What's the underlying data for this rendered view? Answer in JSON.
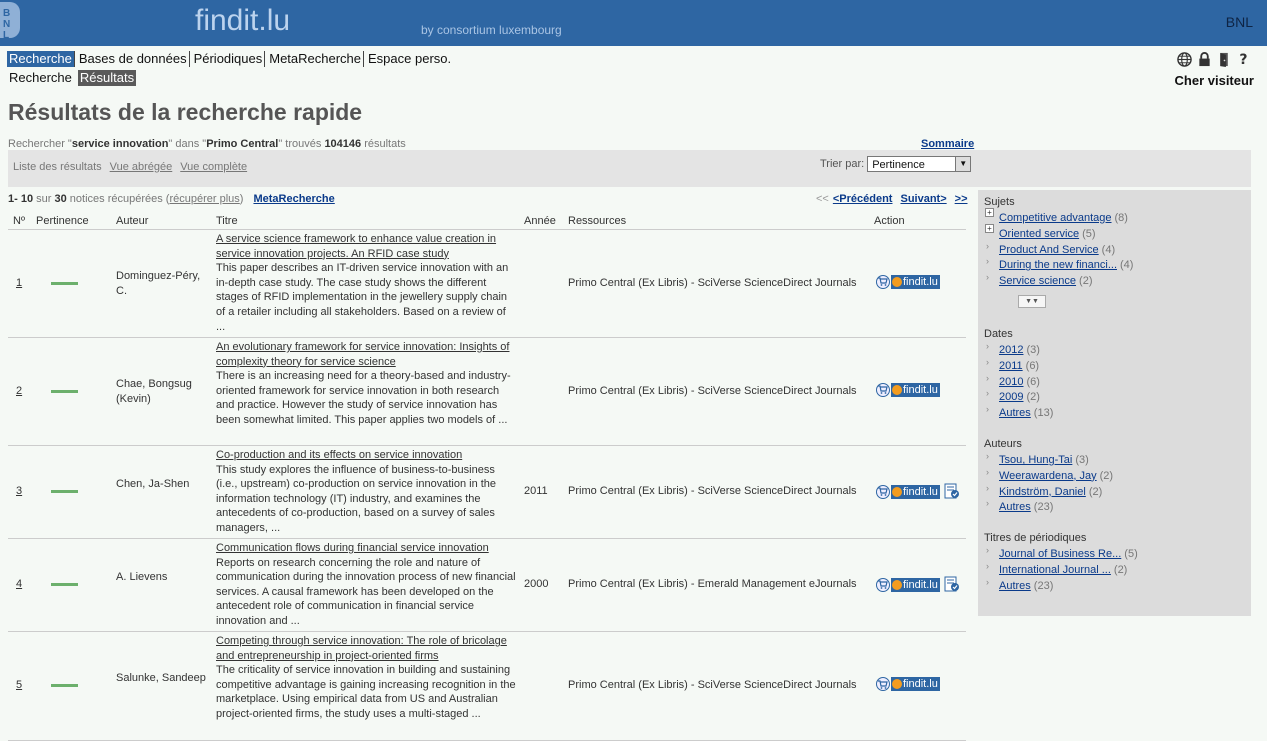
{
  "header": {
    "logo_letters": "B\nN\nL",
    "brand": "findit.lu",
    "byline": "by consortium luxembourg",
    "org": "BNL"
  },
  "nav": {
    "primary": [
      {
        "label": "Recherche",
        "active": true
      },
      {
        "label": "Bases de données",
        "active": false
      },
      {
        "label": "Périodiques",
        "active": false
      },
      {
        "label": "MetaRecherche",
        "active": false
      },
      {
        "label": "Espace perso.",
        "active": false
      }
    ],
    "secondary": [
      {
        "label": "Recherche",
        "active": false
      },
      {
        "label": "Résultats",
        "active": true
      }
    ],
    "tools": [
      "globe-icon",
      "lock-icon",
      "logout-icon",
      "help-icon"
    ],
    "visitor": "Cher visiteur"
  },
  "page": {
    "title": "Résultats de la recherche rapide",
    "summary": {
      "prefix": "Rechercher \"",
      "query": "service innovation",
      "mid1": "\" dans \"",
      "source": "Primo Central",
      "mid2": "\" trouvés ",
      "count": "104146",
      "suffix": " résultats"
    },
    "sommaire": "Sommaire"
  },
  "options": {
    "list_label": "Liste des résultats",
    "view_short": "Vue abrégée",
    "view_full": "Vue complète",
    "sort_label": "Trier par:",
    "sort_value": "Pertinence"
  },
  "results_meta": {
    "range": "1- 10",
    "sur": " sur ",
    "total": "30",
    "retrieved": " notices récupérées (",
    "more": "récupérer plus",
    "close": ")",
    "metasearch": "MetaRecherche"
  },
  "pager": {
    "first": "<<",
    "prev": "<Précédent",
    "next": "Suivant>",
    "last": ">>"
  },
  "table": {
    "headers": {
      "num": "Nº",
      "relevance": "Pertinence",
      "author": "Auteur",
      "title": "Titre",
      "year": "Année",
      "resources": "Ressources",
      "action": "Action"
    },
    "rows": [
      {
        "num": "1",
        "relevance": 0.9,
        "author": "Dominguez-Péry, C.",
        "title": "A service science framework to enhance value creation in service innovation projects. An RFID case study",
        "abstract": "This paper describes an IT-driven service innovation with an in-depth case study. The case study shows the different stages of RFID implementation in the jewellery supply chain of a retailer including all stakeholders. Based on a review of ...",
        "year": "",
        "resource": "Primo Central (Ex Libris) - SciVerse ScienceDirect Journals",
        "doc_icon": false
      },
      {
        "num": "2",
        "relevance": 0.9,
        "author": "Chae, Bongsug (Kevin)",
        "title": "An evolutionary framework for service innovation: Insights of complexity theory for service science",
        "abstract": "There is an increasing need for a theory-based and industry-oriented framework for service innovation in both research and practice. However the study of service innovation has been somewhat limited. This paper applies two models of ...",
        "year": "",
        "resource": "Primo Central (Ex Libris) - SciVerse ScienceDirect Journals",
        "doc_icon": false
      },
      {
        "num": "3",
        "relevance": 0.9,
        "author": "Chen, Ja-Shen",
        "title": "Co-production and its effects on service innovation",
        "abstract": "This study explores the influence of business-to-business (i.e., upstream) co-production on service innovation in the information technology (IT) industry, and examines the antecedents of co-production, based on a survey of sales managers, ...",
        "year": "2011",
        "resource": "Primo Central (Ex Libris) - SciVerse ScienceDirect Journals",
        "doc_icon": true
      },
      {
        "num": "4",
        "relevance": 0.9,
        "author": "A. Lievens",
        "title": "Communication flows during financial service innovation",
        "abstract": "Reports on research concerning the role and nature of communication during the innovation process of new financial services. A causal framework has been developed on the antecedent role of communication in financial service innovation and ...",
        "year": "2000",
        "resource": "Primo Central (Ex Libris) - Emerald Management eJournals",
        "doc_icon": true
      },
      {
        "num": "5",
        "relevance": 0.9,
        "author": "Salunke, Sandeep",
        "title": "Competing through service innovation: The role of bricolage and entrepreneurship in project-oriented firms",
        "abstract": "The criticality of service innovation in building and sustaining competitive advantage is gaining increasing recognition in the marketplace. Using empirical data from US and Australian project-oriented firms, the study uses a multi-staged ...",
        "year": "",
        "resource": "Primo Central (Ex Libris) - SciVerse ScienceDirect Journals",
        "doc_icon": false
      }
    ],
    "action_badge": "findit.lu"
  },
  "facets": {
    "subjects": {
      "title": "Sujets",
      "items": [
        {
          "label": "Competitive advantage ",
          "count": "(8)",
          "marker": "plus"
        },
        {
          "label": "Oriented service ",
          "count": "(5)",
          "marker": "plus"
        },
        {
          "label": "Product And Service ",
          "count": "(4)",
          "marker": "arrow"
        },
        {
          "label": "During the new financi... ",
          "count": "(4)",
          "marker": "arrow"
        },
        {
          "label": "Service science ",
          "count": "(2)",
          "marker": "arrow"
        }
      ]
    },
    "dates": {
      "title": "Dates",
      "items": [
        {
          "label": "2012 ",
          "count": "(3)"
        },
        {
          "label": "2011 ",
          "count": "(6)"
        },
        {
          "label": "2010 ",
          "count": "(6)"
        },
        {
          "label": "2009 ",
          "count": "(2)"
        },
        {
          "label": "Autres ",
          "count": "(13)"
        }
      ]
    },
    "authors": {
      "title": "Auteurs",
      "items": [
        {
          "label": "Tsou, Hung-Tai ",
          "count": "(3)"
        },
        {
          "label": "Weerawardena, Jay ",
          "count": "(2)"
        },
        {
          "label": "Kindström, Daniel ",
          "count": "(2)"
        },
        {
          "label": "Autres ",
          "count": "(23)"
        }
      ]
    },
    "journals": {
      "title": "Titres de périodiques",
      "items": [
        {
          "label": "Journal of Business Re... ",
          "count": "(5)"
        },
        {
          "label": "International Journal ... ",
          "count": "(2)"
        },
        {
          "label": "Autres ",
          "count": "(23)"
        }
      ]
    }
  }
}
